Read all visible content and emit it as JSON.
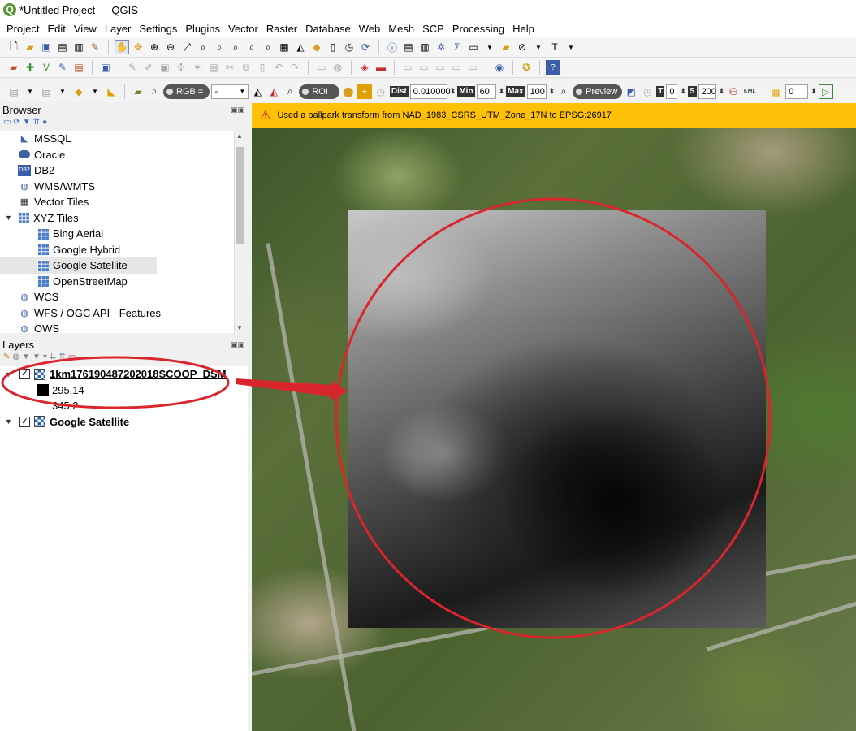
{
  "window": {
    "title": "*Untitled Project — QGIS"
  },
  "menu": [
    "Project",
    "Edit",
    "View",
    "Layer",
    "Settings",
    "Plugins",
    "Vector",
    "Raster",
    "Database",
    "Web",
    "Mesh",
    "SCP",
    "Processing",
    "Help"
  ],
  "scp_toolbar": {
    "rgb_label": "RGB =",
    "rgb_value": "-",
    "roi_label": "ROI",
    "dist_label": "Dist",
    "dist_value": "0.010000",
    "min_label": "Min",
    "min_value": "60",
    "max_label": "Max",
    "max_value": "100",
    "preview_label": "Preview",
    "t_label": "T",
    "t_value": "0",
    "s_label": "S",
    "s_value": "200",
    "band_value": "0"
  },
  "browser": {
    "title": "Browser",
    "items": [
      {
        "label": "MSSQL",
        "icon": "mssql-icon",
        "indent": 1
      },
      {
        "label": "Oracle",
        "icon": "oracle-icon",
        "indent": 1
      },
      {
        "label": "DB2",
        "icon": "db2-icon",
        "indent": 1
      },
      {
        "label": "WMS/WMTS",
        "icon": "globe-icon",
        "indent": 1
      },
      {
        "label": "Vector Tiles",
        "icon": "vector-tiles-icon",
        "indent": 1
      },
      {
        "label": "XYZ Tiles",
        "icon": "xyz-tiles-icon",
        "indent": 1,
        "expanded": true
      },
      {
        "label": "Bing Aerial",
        "icon": "tile-grid-icon",
        "indent": 2
      },
      {
        "label": "Google Hybrid",
        "icon": "tile-grid-icon",
        "indent": 2
      },
      {
        "label": "Google Satellite",
        "icon": "tile-grid-icon",
        "indent": 2,
        "selected": true
      },
      {
        "label": "OpenStreetMap",
        "icon": "tile-grid-icon",
        "indent": 2
      },
      {
        "label": "WCS",
        "icon": "globe-icon",
        "indent": 1
      },
      {
        "label": "WFS / OGC API - Features",
        "icon": "globe-icon",
        "indent": 1
      },
      {
        "label": "OWS",
        "icon": "globe-icon",
        "indent": 1
      }
    ]
  },
  "layers": {
    "title": "Layers",
    "dsm_layer": {
      "name": "1km176190487202018SCOOP_DSM",
      "checked": true,
      "min": "295.14",
      "max": "345.2"
    },
    "satellite_layer": {
      "name": "Google Satellite",
      "checked": true
    }
  },
  "map": {
    "warning": "Used a ballpark transform from NAD_1983_CSRS_UTM_Zone_17N to EPSG:26917"
  },
  "colors": {
    "warning_bar": "#ffc107",
    "annotation_red": "#d9262c",
    "selection": "#e6e6e6"
  }
}
